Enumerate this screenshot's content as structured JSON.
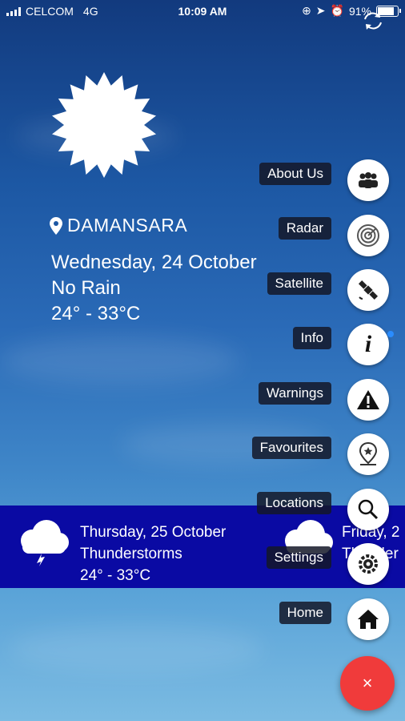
{
  "status_bar": {
    "carrier": "CELCOM",
    "network": "4G",
    "time": "10:09 AM",
    "battery_percent": "91%",
    "battery_level": 0.91
  },
  "current": {
    "icon": "sun-icon",
    "location": "DAMANSARA",
    "date": "Wednesday, 24 October",
    "condition": "No Rain",
    "temp_range": "24° - 33°C"
  },
  "forecast": [
    {
      "icon": "thunder-cloud-icon",
      "date": "Thursday, 25 October",
      "condition": "Thunderstorms",
      "temp_range": "24° - 33°C"
    },
    {
      "icon": "cloud-icon",
      "date": "Friday, 2",
      "condition": "Thunder",
      "temp_range": ""
    }
  ],
  "menu": [
    {
      "label": "About Us",
      "icon": "group-icon"
    },
    {
      "label": "Radar",
      "icon": "radar-icon"
    },
    {
      "label": "Satellite",
      "icon": "satellite-icon"
    },
    {
      "label": "Info",
      "icon": "info-icon"
    },
    {
      "label": "Warnings",
      "icon": "warning-icon"
    },
    {
      "label": "Favourites",
      "icon": "favourite-pin-icon"
    },
    {
      "label": "Locations",
      "icon": "search-icon"
    },
    {
      "label": "Settings",
      "icon": "settings-icon"
    },
    {
      "label": "Home",
      "icon": "home-icon"
    }
  ],
  "fab": {
    "label": "×",
    "color": "#f03b3b"
  },
  "colors": {
    "forecast_band": "#0a0aa3"
  }
}
